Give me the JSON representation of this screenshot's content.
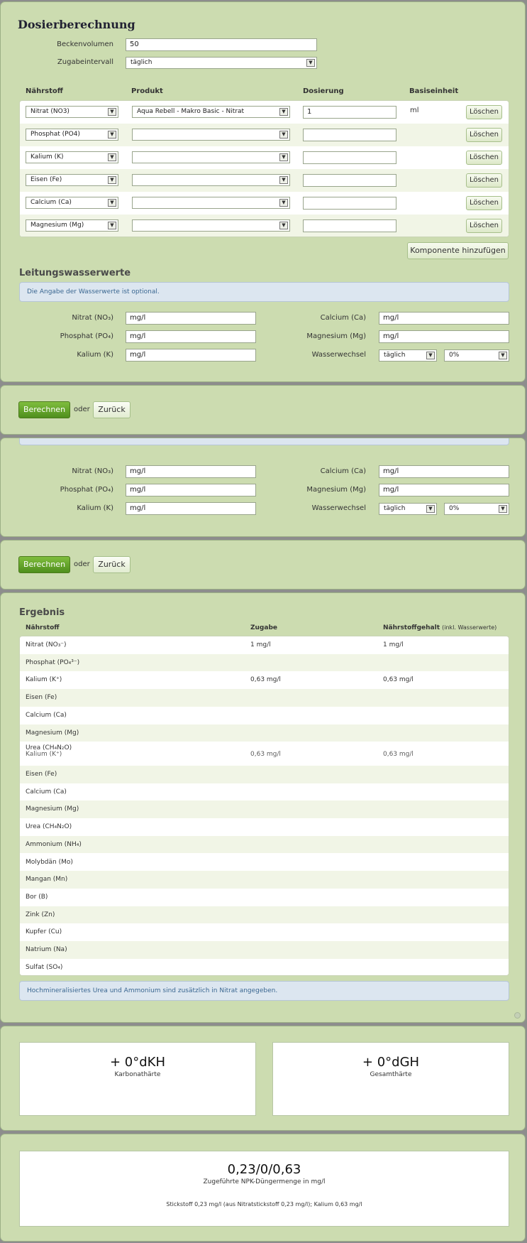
{
  "form": {
    "title": "Dosierberechnung",
    "volume_label": "Beckenvolumen",
    "volume_value": "50",
    "interval_label": "Zugabeintervall",
    "interval_value": "täglich"
  },
  "components": {
    "headers": {
      "naehrstoff": "Nährstoff",
      "produkt": "Produkt",
      "dosierung": "Dosierung",
      "einheit": "Basiseinheit"
    },
    "rows": [
      {
        "naehrstoff": "Nitrat (NO3)",
        "produkt": "Aqua Rebell - Makro Basic - Nitrat",
        "dosierung": "1",
        "einheit": "ml",
        "delete": "Löschen"
      },
      {
        "naehrstoff": "Phosphat (PO4)",
        "produkt": "",
        "dosierung": "",
        "einheit": "",
        "delete": "Löschen"
      },
      {
        "naehrstoff": "Kalium (K)",
        "produkt": "",
        "dosierung": "",
        "einheit": "",
        "delete": "Löschen"
      },
      {
        "naehrstoff": "Eisen (Fe)",
        "produkt": "",
        "dosierung": "",
        "einheit": "",
        "delete": "Löschen"
      },
      {
        "naehrstoff": "Calcium (Ca)",
        "produkt": "",
        "dosierung": "",
        "einheit": "",
        "delete": "Löschen"
      },
      {
        "naehrstoff": "Magnesium (Mg)",
        "produkt": "",
        "dosierung": "",
        "einheit": "",
        "delete": "Löschen"
      }
    ],
    "add_button": "Komponente hinzufügen"
  },
  "tap": {
    "title": "Leitungswasserwerte",
    "info": "Die Angabe der Wasserwerte ist optional.",
    "nitrat_label": "Nitrat (NO₃)",
    "nitrat_value": "mg/l",
    "phosphat_label": "Phosphat (PO₄)",
    "phosphat_value": "mg/l",
    "kalium_label": "Kalium (K)",
    "kalium_value": "mg/l",
    "calcium_label": "Calcium (Ca)",
    "calcium_value": "mg/l",
    "magnesium_label": "Magnesium (Mg)",
    "magnesium_value": "mg/l",
    "wechsel_label": "Wasserwechsel",
    "wechsel_interval": "täglich",
    "wechsel_percent": "0%"
  },
  "actions": {
    "calc": "Berechnen",
    "or": "oder",
    "back": "Zurück"
  },
  "result": {
    "title": "Ergebnis",
    "headers": {
      "naehrstoff": "Nährstoff",
      "zugabe": "Zugabe",
      "gehalt": "Nährstoffgehalt",
      "gehalt_note": "(inkl. Wasserwerte)"
    },
    "rows_top": [
      {
        "n": "Nitrat (NO₃⁻)",
        "z": "1 mg/l",
        "g": "1 mg/l"
      },
      {
        "n": "Phosphat (PO₄³⁻)",
        "z": "",
        "g": ""
      },
      {
        "n": "Kalium (K⁺)",
        "z": "0,63 mg/l",
        "g": "0,63 mg/l"
      },
      {
        "n": "Eisen (Fe)",
        "z": "",
        "g": ""
      },
      {
        "n": "Calcium (Ca)",
        "z": "",
        "g": ""
      },
      {
        "n": "Magnesium (Mg)",
        "z": "",
        "g": ""
      }
    ],
    "glitch_urea": "Urea (CH₄N₂O)",
    "glitch_kalium": "Kalium (K⁺)",
    "glitch_zugabe": "0,63 mg/l",
    "glitch_gehalt": "0,63 mg/l",
    "rows_bottom": [
      {
        "n": "Eisen (Fe)"
      },
      {
        "n": "Calcium (Ca)"
      },
      {
        "n": "Magnesium (Mg)"
      },
      {
        "n": "Urea (CH₄N₂O)"
      },
      {
        "n": "Ammonium (NH₄)"
      },
      {
        "n": "Molybdän (Mo)"
      },
      {
        "n": "Mangan (Mn)"
      },
      {
        "n": "Bor (B)"
      },
      {
        "n": "Zink (Zn)"
      },
      {
        "n": "Kupfer (Cu)"
      },
      {
        "n": "Natrium (Na)"
      },
      {
        "n": "Sulfat (SO₄)"
      }
    ],
    "info": "Hochmineralisiertes Urea und Ammonium sind zusätzlich in Nitrat angegeben."
  },
  "hardness": {
    "kh_value": "+ 0°dKH",
    "kh_label": "Karbonathärte",
    "gh_value": "+ 0°dGH",
    "gh_label": "Gesamthärte"
  },
  "npk": {
    "value": "0,23/0/0,63",
    "label": "Zugeführte NPK-Düngermenge in mg/l",
    "detail": "Stickstoff 0,23 mg/l (aus Nitratstickstoff 0,23 mg/l); Kalium 0,63 mg/l"
  }
}
